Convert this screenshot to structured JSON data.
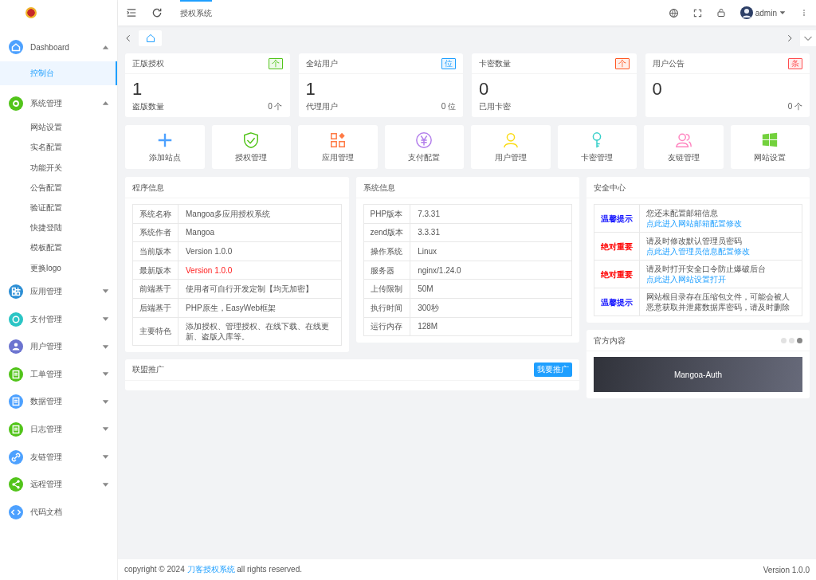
{
  "header": {
    "tab": {
      "label": "授权系统",
      "selected": true
    },
    "user": "admin"
  },
  "sidebar": {
    "items": [
      {
        "kind": "group",
        "label": "Dashboard",
        "color": "#4da1ff",
        "expanded": true,
        "children": [
          {
            "label": "控制台",
            "selected": true
          }
        ]
      },
      {
        "kind": "group",
        "label": "系统管理",
        "color": "#52c41a",
        "expanded": true,
        "children": [
          {
            "label": "网站设置",
            "selected": false
          },
          {
            "label": "实名配置",
            "selected": false
          },
          {
            "label": "功能开关",
            "selected": false
          },
          {
            "label": "公告配置",
            "selected": false
          },
          {
            "label": "验证配置",
            "selected": false
          },
          {
            "label": "快捷登陆",
            "selected": false
          },
          {
            "label": "模板配置",
            "selected": false
          },
          {
            "label": "更换logo",
            "selected": false
          }
        ]
      },
      {
        "kind": "group",
        "label": "应用管理",
        "color": "#2d8fd5",
        "expanded": false
      },
      {
        "kind": "group",
        "label": "支付管理",
        "color": "#2bc5c5",
        "expanded": false
      },
      {
        "kind": "group",
        "label": "用户管理",
        "color": "#6c74d0",
        "expanded": false
      },
      {
        "kind": "group",
        "label": "工单管理",
        "color": "#52c41a",
        "expanded": false
      },
      {
        "kind": "group",
        "label": "数据管理",
        "color": "#4da1ff",
        "expanded": false
      },
      {
        "kind": "group",
        "label": "日志管理",
        "color": "#52c41a",
        "expanded": false
      },
      {
        "kind": "group",
        "label": "友链管理",
        "color": "#4da1ff",
        "expanded": false
      },
      {
        "kind": "group",
        "label": "远程管理",
        "color": "#52c41a",
        "expanded": false
      },
      {
        "kind": "link",
        "label": "代码文档",
        "color": "#4da1ff"
      }
    ]
  },
  "stats": [
    {
      "title": "正版授权",
      "badge": "个",
      "color": "#52c41a",
      "value": "1",
      "label": "盗版数量",
      "count": "0 个"
    },
    {
      "title": "全站用户",
      "badge": "位",
      "color": "#1e9fff",
      "value": "1",
      "label": "代理用户",
      "count": "0 位"
    },
    {
      "title": "卡密数量",
      "badge": "个",
      "color": "#ff5722",
      "value": "0",
      "label": "已用卡密"
    },
    {
      "title": "用户公告",
      "badge": "条",
      "color": "#ff4d4f",
      "value": "0",
      "count": "0 个"
    }
  ],
  "shortcuts": [
    {
      "label": "添加站点",
      "kind": "plus",
      "color": "#4da1ff"
    },
    {
      "label": "授权管理",
      "kind": "shield",
      "color": "#52c41a"
    },
    {
      "label": "应用管理",
      "kind": "apps",
      "color": "#ff7a45"
    },
    {
      "label": "支付配置",
      "kind": "yen",
      "color": "#b37feb"
    },
    {
      "label": "用户管理",
      "kind": "user",
      "color": "#fadb14"
    },
    {
      "label": "卡密管理",
      "kind": "key",
      "color": "#36cfc9"
    },
    {
      "label": "友链管理",
      "kind": "users",
      "color": "#ff85c0"
    },
    {
      "label": "网站设置",
      "kind": "windows",
      "color": "#73d13d"
    }
  ],
  "program_info": {
    "title": "程序信息",
    "rows": [
      {
        "key": "系统名称",
        "value": "Mangoa多应用授权系统",
        "highlight": false
      },
      {
        "key": "系统作者",
        "value": "Mangoa",
        "highlight": false
      },
      {
        "key": "当前版本",
        "value": "Version 1.0.0",
        "highlight": false
      },
      {
        "key": "最新版本",
        "value": "Version 1.0.0",
        "highlight": true
      },
      {
        "key": "前端基于",
        "value": "使用者可自行开发定制【均无加密】",
        "highlight": false
      },
      {
        "key": "后端基于",
        "value": "PHP原生，EasyWeb框架",
        "highlight": false
      },
      {
        "key": "主要特色",
        "value": "添加授权、管理授权、在线下载、在线更新、盗版入库等。",
        "highlight": false
      }
    ]
  },
  "system_info": {
    "title": "系统信息",
    "rows": [
      {
        "key": "PHP版本",
        "value": "7.3.31"
      },
      {
        "key": "zend版本",
        "value": "3.3.31"
      },
      {
        "key": "操作系统",
        "value": "Linux"
      },
      {
        "key": "服务器",
        "value": "nginx/1.24.0"
      },
      {
        "key": "上传限制",
        "value": "50M"
      },
      {
        "key": "执行时间",
        "value": "300秒"
      },
      {
        "key": "运行内存",
        "value": "128M"
      }
    ]
  },
  "promo": {
    "title": "联盟推广",
    "button": "我要推广"
  },
  "security": {
    "title": "安全中心",
    "rows": [
      {
        "kind": "tip",
        "label": "温馨提示",
        "text": "您还未配置邮箱信息",
        "link": "点此进入网站邮箱配置修改"
      },
      {
        "kind": "critical",
        "label": "绝对重要",
        "text": "请及时修改默认管理员密码",
        "link": "点此进入管理员信息配置修改"
      },
      {
        "kind": "critical",
        "label": "绝对重要",
        "text": "请及时打开安全口令防止爆破后台",
        "link": "点此进入网站设置打开"
      },
      {
        "kind": "tip",
        "label": "温馨提示",
        "text": "网站根目录存在压缩包文件，可能会被人恶意获取并泄露数据库密码，请及时删除"
      }
    ]
  },
  "official": {
    "title": "官方内容",
    "slides": [
      {
        "selected": false
      },
      {
        "selected": false
      },
      {
        "selected": true
      }
    ],
    "banner": "Mangoa-Auth"
  },
  "footer": {
    "prefix": "copyright © 2024 ",
    "link": "刀客授权系统",
    "suffix": " all rights reserved.",
    "version": "Version 1.0.0"
  }
}
